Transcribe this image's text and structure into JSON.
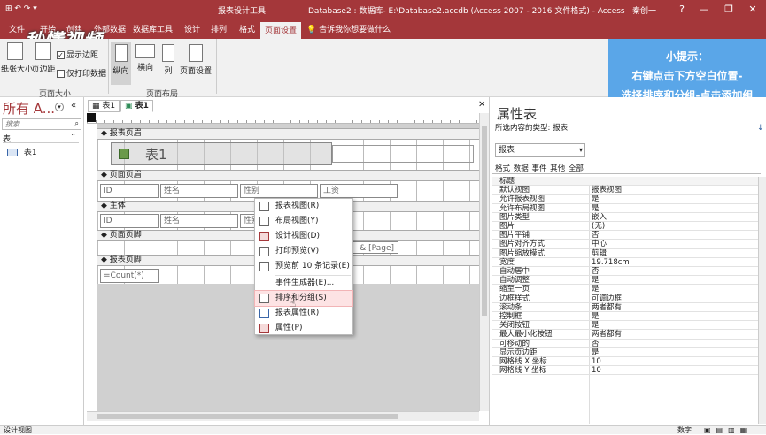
{
  "titlebar": {
    "context_tool": "报表设计工具",
    "title": "Database2 : 数据库- E:\\Database2.accdb (Access 2007 - 2016 文件格式)  -  Access",
    "user": "秦创一",
    "help": "?",
    "min": "—",
    "restore": "❐",
    "close": "✕"
  },
  "ribbon_tabs": [
    "文件",
    "开始",
    "创建",
    "外部数据",
    "数据库工具",
    "设计",
    "排列",
    "格式",
    "页面设置"
  ],
  "tell_me": "告诉我你想要做什么",
  "logo_text": "秒懂视频",
  "ribbon": {
    "paper_size": "纸张大小",
    "margins": "页边距",
    "show_margins": "显示边距",
    "print_data_only": "仅打印数据",
    "group_page_size": "页面大小",
    "portrait": "纵向",
    "landscape": "横向",
    "columns": "列",
    "page_setup": "页面设置",
    "group_page_layout": "页面布局"
  },
  "hint": {
    "line1": "小提示：",
    "line2": "右键点击下方空白位置-",
    "line3": "选择排序和分组-点击添加组"
  },
  "nav": {
    "title": "所有 A...",
    "search_placeholder": "搜索...",
    "section": "表",
    "item": "表1"
  },
  "doc_tabs": [
    "表1",
    "表1"
  ],
  "sections": {
    "report_header": "报表页眉",
    "page_header": "页面页眉",
    "detail": "主体",
    "page_footer": "页面页脚",
    "report_footer": "报表页脚"
  },
  "controls": {
    "report_title": "表1",
    "lbl_id": "ID",
    "lbl_name": "姓名",
    "lbl_gender": "性别",
    "lbl_salary": "工资",
    "txt_id": "ID",
    "txt_name": "姓名",
    "txt_gender": "性别",
    "page_expr": "& [Page]",
    "count_expr": "=Count(*)"
  },
  "context_menu": [
    {
      "label": "报表视图(R)",
      "highlighted": false
    },
    {
      "label": "布局视图(Y)",
      "highlighted": false
    },
    {
      "label": "设计视图(D)",
      "highlighted": false
    },
    {
      "label": "打印预览(V)",
      "highlighted": false
    },
    {
      "label": "预览前 10 条记录(E)",
      "highlighted": false
    },
    {
      "label": "事件生成器(E)...",
      "highlighted": false
    },
    {
      "label": "排序和分组(S)",
      "highlighted": true
    },
    {
      "label": "报表属性(R)",
      "highlighted": false
    },
    {
      "label": "属性(P)",
      "highlighted": false
    }
  ],
  "property_sheet": {
    "title": "属性表",
    "subtitle": "所选内容的类型: 报表",
    "selector": "报表",
    "tabs": [
      "格式",
      "数据",
      "事件",
      "其他",
      "全部"
    ],
    "rows": [
      [
        "标题",
        ""
      ],
      [
        "默认视图",
        "报表视图"
      ],
      [
        "允许报表视图",
        "是"
      ],
      [
        "允许布局视图",
        "是"
      ],
      [
        "图片类型",
        "嵌入"
      ],
      [
        "图片",
        "(无)"
      ],
      [
        "图片平铺",
        "否"
      ],
      [
        "图片对齐方式",
        "中心"
      ],
      [
        "图片缩放模式",
        "剪辑"
      ],
      [
        "宽度",
        "19.718cm"
      ],
      [
        "自动居中",
        "否"
      ],
      [
        "自动调整",
        "是"
      ],
      [
        "缩至一页",
        "是"
      ],
      [
        "边框样式",
        "可调边框"
      ],
      [
        "滚动条",
        "两者都有"
      ],
      [
        "控制框",
        "是"
      ],
      [
        "关闭按钮",
        "是"
      ],
      [
        "最大最小化按钮",
        "两者都有"
      ],
      [
        "可移动的",
        "否"
      ],
      [
        "显示页边距",
        "是"
      ],
      [
        "网格线 X 坐标",
        "10"
      ],
      [
        "网格线 Y 坐标",
        "10"
      ]
    ]
  },
  "status": {
    "left": "设计视图",
    "right": "数字"
  }
}
